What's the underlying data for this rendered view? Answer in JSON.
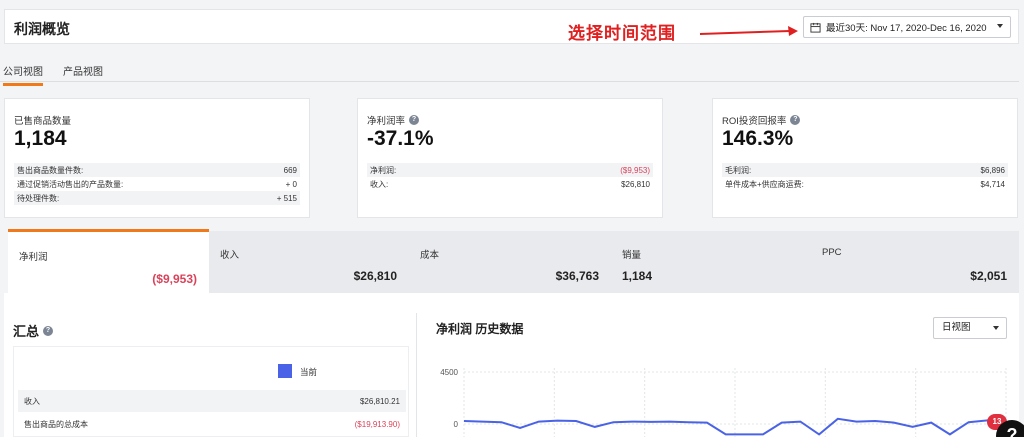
{
  "header": {
    "title": "利润概览"
  },
  "annotation": {
    "text": "选择时间范围"
  },
  "date_range": {
    "label": "最近30天: Nov 17, 2020-Dec 16, 2020"
  },
  "tabs": [
    {
      "label": "公司视图"
    },
    {
      "label": "产品视图"
    }
  ],
  "cards": [
    {
      "label": "已售商品数量",
      "value": "1,184",
      "rows": [
        {
          "label": "售出商品数量件数:",
          "value": "669"
        },
        {
          "label": "通过促销活动售出的产品数量:",
          "value": "+ 0"
        },
        {
          "label": "待处理件数:",
          "value": "+ 515"
        }
      ]
    },
    {
      "label": "净利润率",
      "value": "-37.1%",
      "rows": [
        {
          "label": "净利润:",
          "value": "($9,953)"
        },
        {
          "label": "收入:",
          "value": "$26,810"
        }
      ]
    },
    {
      "label": "ROI投资回报率",
      "value": "146.3%",
      "rows": [
        {
          "label": "毛利润:",
          "value": "$6,896"
        },
        {
          "label": "单件成本+供应商运费:",
          "value": "$4,714"
        }
      ]
    }
  ],
  "metrics": [
    {
      "label": "净利润",
      "value": "($9,953)"
    },
    {
      "label": "收入",
      "value": "$26,810"
    },
    {
      "label": "成本",
      "value": "$36,763"
    },
    {
      "label": "销量",
      "value": "1,184"
    },
    {
      "label": "PPC",
      "value": "$2,051"
    }
  ],
  "summary": {
    "title": "汇总",
    "legend": "当前",
    "rows": [
      {
        "label": "收入",
        "value": "$26,810.21"
      },
      {
        "label": "售出商品的总成本",
        "value": "($19,913.90)"
      }
    ]
  },
  "history": {
    "title": "净利润 历史数据",
    "view_select": "日视图"
  },
  "chart_data": {
    "type": "line",
    "series_color": "#4a63e6",
    "y_ticks": [
      "4500",
      "0"
    ],
    "ylim_visible": [
      -700,
      4500
    ],
    "values": [
      260,
      210,
      160,
      -350,
      210,
      290,
      260,
      -250,
      160,
      210,
      180,
      210,
      160,
      120,
      -900,
      -900,
      -900,
      120,
      210,
      -900,
      450,
      210,
      260,
      120,
      -250,
      120,
      -900,
      160,
      310,
      -900
    ]
  },
  "notifications": {
    "count": "13"
  },
  "help": {
    "label": "?"
  },
  "colors": {
    "accent": "#f07a1a",
    "negative": "#d9435a",
    "annotation": "#e02020",
    "series": "#4a63e6"
  },
  "icons": {
    "calendar": "calendar-icon",
    "help": "question-circle-icon",
    "caret": "caret-down-icon"
  }
}
